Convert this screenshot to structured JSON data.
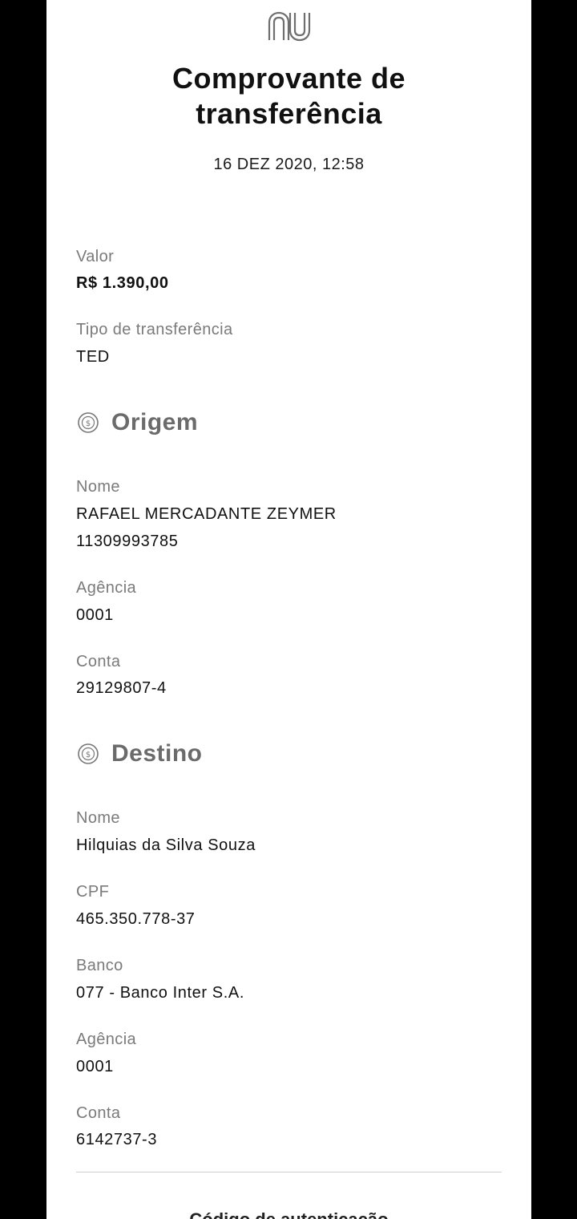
{
  "header": {
    "logo_name": "nu-logo",
    "title": "Comprovante de\ntransferência",
    "datetime": "16 DEZ 2020, 12:58"
  },
  "summary": {
    "valor_label": "Valor",
    "valor_value": "R$ 1.390,00",
    "tipo_label": "Tipo de transferência",
    "tipo_value": "TED"
  },
  "origem": {
    "title": "Origem",
    "icon": "dollar-coin-icon",
    "nome_label": "Nome",
    "nome_value": "RAFAEL MERCADANTE ZEYMER",
    "nome_value2": "11309993785",
    "agencia_label": "Agência",
    "agencia_value": "0001",
    "conta_label": "Conta",
    "conta_value": "29129807-4"
  },
  "destino": {
    "title": "Destino",
    "icon": "dollar-coin-icon",
    "nome_label": "Nome",
    "nome_value": "Hilquias da Silva Souza",
    "cpf_label": "CPF",
    "cpf_value": "465.350.778-37",
    "banco_label": "Banco",
    "banco_value": "077 - Banco Inter S.A.",
    "agencia_label": "Agência",
    "agencia_value": "0001",
    "conta_label": "Conta",
    "conta_value": "6142737-3"
  },
  "footer": {
    "partial_text": "Código de autenticação"
  },
  "colors": {
    "page_background": "#000000",
    "sheet_background": "#ffffff",
    "label_gray": "#7a7a7a",
    "section_gray": "#6b6b6b",
    "text_dark": "#111111"
  }
}
